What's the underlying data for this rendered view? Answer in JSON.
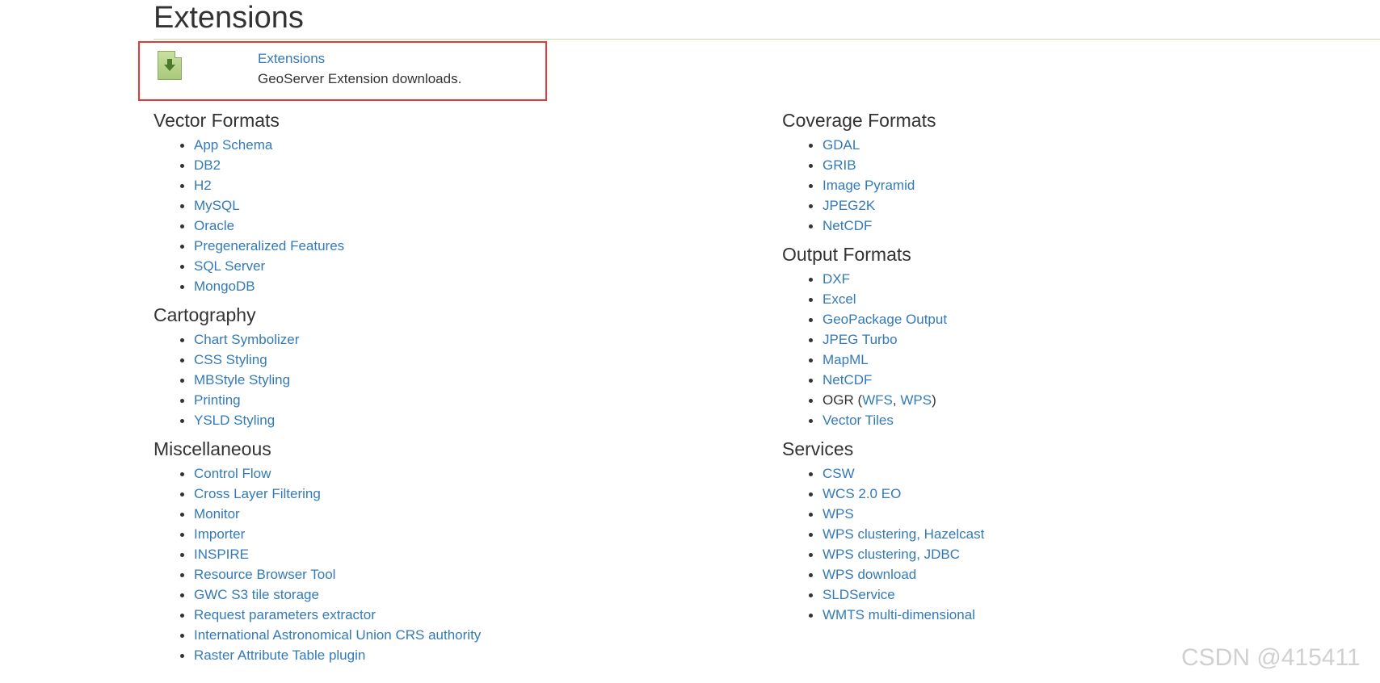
{
  "page": {
    "title": "Extensions"
  },
  "callout": {
    "link": "Extensions",
    "description": "GeoServer Extension downloads.",
    "icon": "download-icon"
  },
  "left_sections": [
    {
      "title": "Vector Formats",
      "items": [
        "App Schema",
        "DB2",
        "H2",
        "MySQL",
        "Oracle",
        "Pregeneralized Features",
        "SQL Server",
        "MongoDB"
      ]
    },
    {
      "title": "Cartography",
      "items": [
        "Chart Symbolizer",
        "CSS Styling",
        "MBStyle Styling",
        "Printing",
        "YSLD Styling"
      ]
    },
    {
      "title": "Miscellaneous",
      "items": [
        "Control Flow",
        "Cross Layer Filtering",
        "Monitor",
        "Importer",
        "INSPIRE",
        "Resource Browser Tool",
        "GWC S3 tile storage",
        "Request parameters extractor",
        "International Astronomical Union CRS authority",
        "Raster Attribute Table plugin"
      ]
    }
  ],
  "right_sections": {
    "coverage": {
      "title": "Coverage Formats",
      "items": [
        "GDAL",
        "GRIB",
        "Image Pyramid",
        "JPEG2K",
        "NetCDF"
      ]
    },
    "output": {
      "title": "Output Formats",
      "items": [
        "DXF",
        "Excel",
        "GeoPackage Output",
        "JPEG Turbo",
        "MapML",
        "NetCDF"
      ],
      "ogr": {
        "prefix": "OGR (",
        "wfs": "WFS",
        "sep": ", ",
        "wps": "WPS",
        "suffix": ")"
      },
      "last": "Vector Tiles"
    },
    "services": {
      "title": "Services",
      "items": [
        "CSW",
        "WCS 2.0 EO",
        "WPS",
        "WPS clustering, Hazelcast",
        "WPS clustering, JDBC",
        "WPS download",
        "SLDService",
        "WMTS multi-dimensional"
      ]
    }
  },
  "watermark": "CSDN @415411",
  "colors": {
    "link": "#337ab7",
    "text": "#333333",
    "highlight_border": "#e53935",
    "rule": "#c9dca5"
  }
}
